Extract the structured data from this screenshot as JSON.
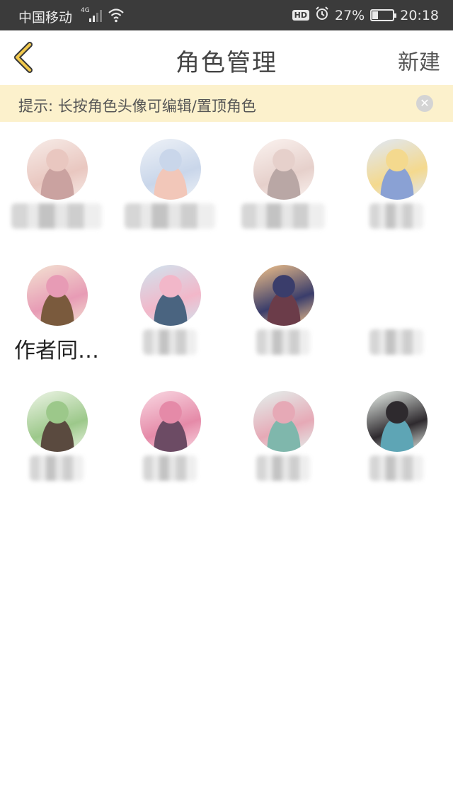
{
  "status_bar": {
    "carrier": "中国移动",
    "network": "4G",
    "battery": "27%",
    "time": "20:18",
    "hd_badge": "HD"
  },
  "nav": {
    "title": "角色管理",
    "new_label": "新建"
  },
  "tip": {
    "text": "提示: 长按角色头像可编辑/置顶角色"
  },
  "characters": [
    {
      "name": "",
      "avatar_colors": [
        "#f7ece8",
        "#e9c7c0",
        "#caa2a0"
      ]
    },
    {
      "name": "",
      "avatar_colors": [
        "#eef2f7",
        "#c9d6ea",
        "#f2c7b9"
      ]
    },
    {
      "name": "",
      "avatar_colors": [
        "#fbf3f0",
        "#e6d0cb",
        "#b9a7a5"
      ]
    },
    {
      "name": "",
      "avatar_colors": [
        "#dfe8f7",
        "#f4d98e",
        "#8aa1d4"
      ]
    },
    {
      "name": "作者同…",
      "avatar_colors": [
        "#f3e3d2",
        "#e79bb5",
        "#7a5a3d"
      ]
    },
    {
      "name": "",
      "avatar_colors": [
        "#cfe4ef",
        "#f2b7c9",
        "#4a6480"
      ]
    },
    {
      "name": "",
      "avatar_colors": [
        "#f4c38a",
        "#3a3d6b",
        "#6b3c49"
      ]
    },
    {
      "name": "",
      "avatar_colors": [
        "#ffffff",
        "#ffffff",
        "#ffffff"
      ]
    },
    {
      "name": "",
      "avatar_colors": [
        "#eef5e7",
        "#9cc88a",
        "#5a4a3f"
      ]
    },
    {
      "name": "",
      "avatar_colors": [
        "#f9d9e3",
        "#e58aa8",
        "#6c4b64"
      ]
    },
    {
      "name": "",
      "avatar_colors": [
        "#e3f2ee",
        "#e6a9b6",
        "#7fb7ac"
      ]
    },
    {
      "name": "",
      "avatar_colors": [
        "#eef5ef",
        "#2e2a2e",
        "#5ea5b5"
      ]
    }
  ]
}
